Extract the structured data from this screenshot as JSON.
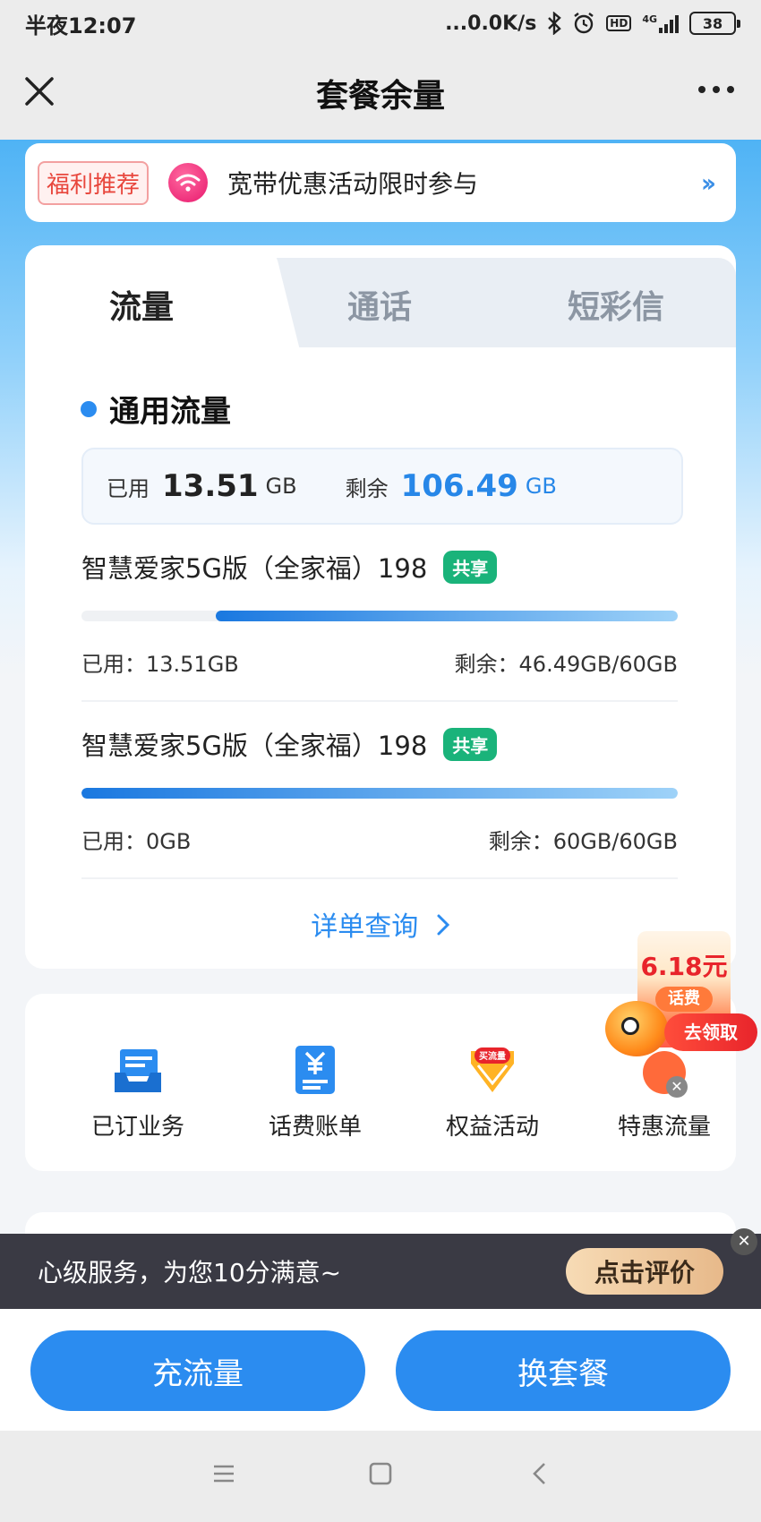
{
  "status_bar": {
    "time": "半夜12:07",
    "network_speed": "...0.0K/s",
    "hd_label": "HD",
    "network_type": "4G",
    "battery": "38"
  },
  "nav": {
    "title": "套餐余量",
    "close_icon": "close-icon",
    "more_icon": "more-icon"
  },
  "promo": {
    "tag": "福利推荐",
    "text": "宽带优惠活动限时参与",
    "arrow": "››"
  },
  "tabs": [
    {
      "label": "流量",
      "active": true
    },
    {
      "label": "通话",
      "active": false
    },
    {
      "label": "短彩信",
      "active": false
    }
  ],
  "section": {
    "title": "通用流量"
  },
  "summary": {
    "used_label": "已用",
    "used_value": "13.51",
    "used_unit": "GB",
    "remaining_label": "剩余",
    "remaining_value": "106.49",
    "remaining_unit": "GB"
  },
  "plans": [
    {
      "name": "智慧爱家5G版（全家福）198",
      "badge": "共享",
      "used_text": "已用：13.51GB",
      "remaining_text": "剩余：46.49GB/60GB",
      "remaining_fraction": 0.775
    },
    {
      "name": "智慧爱家5G版（全家福）198",
      "badge": "共享",
      "used_text": "已用：0GB",
      "remaining_text": "剩余：60GB/60GB",
      "remaining_fraction": 1.0
    }
  ],
  "detail_link": "详单查询",
  "services": [
    {
      "label": "已订业务",
      "icon": "subscription-icon"
    },
    {
      "label": "话费账单",
      "icon": "bill-icon"
    },
    {
      "label": "权益活动",
      "icon": "rights-icon",
      "icon_text": "买流量"
    },
    {
      "label": "特惠流量",
      "icon": "discount-icon"
    }
  ],
  "float_promo": {
    "amount": "6.18元",
    "fee_label": "话费",
    "action": "去领取"
  },
  "feedback": {
    "text": "心级服务，为您10分满意~",
    "button": "点击评价"
  },
  "bottom_buttons": {
    "recharge": "充流量",
    "change_plan": "换套餐"
  },
  "colors": {
    "primary": "#2b8cf0",
    "badge_green": "#1ab37a",
    "promo_red": "#e8473d"
  }
}
